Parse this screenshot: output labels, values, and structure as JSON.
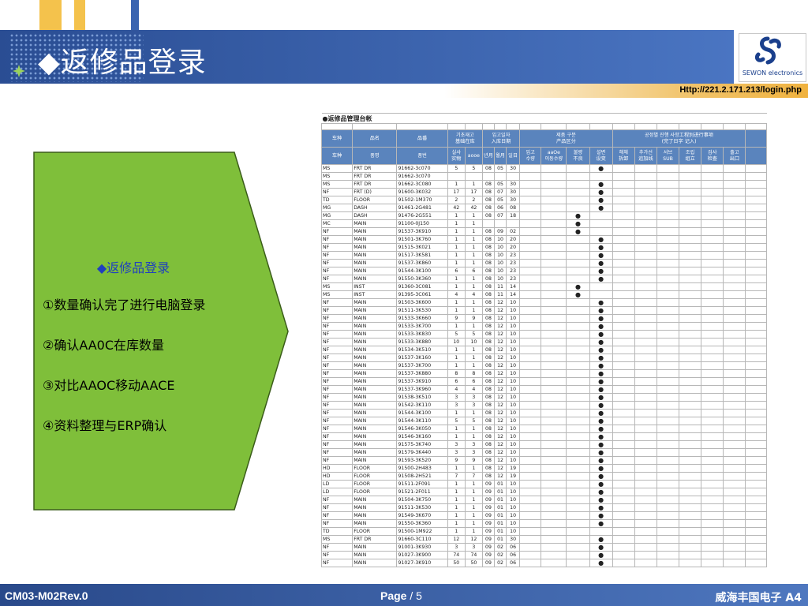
{
  "header": {
    "title": "◆返修品登录",
    "url": "Http://221.2.171.213/login.php",
    "logo_text": "SEWON electronics"
  },
  "colors": {
    "banner": "#3a64b0",
    "arrow_fill": "#7fbf3a",
    "table_header": "#5a84bd",
    "accent_yellow": "#f0b23e"
  },
  "steps": {
    "head": "◆返修品登录",
    "items": [
      "①数量确认完了进行电脑登录",
      "②确认AA0C在库数量",
      "③对比AAOC移动AACE",
      "④资料整理与ERP确认"
    ]
  },
  "table": {
    "caption": "●返修品管理台帐",
    "header1": [
      "车种",
      "品名",
      "品番",
      "기초재고\n基础在库",
      "입고일자\n入库日期",
      "제품 구분\n产品区分",
      "공정별 진행 사항工程別进行事项\n(完了日字 记入)"
    ],
    "header2": [
      "车种",
      "품명",
      "품번",
      "실사\n实物",
      "aooe",
      "년月",
      "월月",
      "일日",
      "입고\n수량",
      "aaOe\n이동수량",
      "불량\n不良",
      "설변\n设变",
      "해체\n拆卸",
      "추가선\n追加线",
      "서브\nSUB",
      "조립\n组立",
      "검사\n检查",
      "출고\n出口"
    ],
    "rows": [
      [
        "MS",
        "FRT DR",
        "91662-3c070",
        "5",
        "5",
        "08",
        "05",
        "30",
        "",
        "",
        "",
        "●"
      ],
      [
        "MS",
        "FRT DR",
        "91662-3c070",
        "",
        "",
        "",
        "",
        "",
        "",
        "",
        "",
        ""
      ],
      [
        "MS",
        "FRT DR",
        "91662-3C080",
        "1",
        "1",
        "08",
        "05",
        "30",
        "",
        "",
        "",
        "●"
      ],
      [
        "NF",
        "FRT (D)",
        "91600-3K032",
        "17",
        "17",
        "08",
        "07",
        "30",
        "",
        "",
        "",
        "●"
      ],
      [
        "TD",
        "FLOOR",
        "91502-1M370",
        "2",
        "2",
        "08",
        "05",
        "30",
        "",
        "",
        "",
        "●"
      ],
      [
        "MG",
        "DASH",
        "91461-2G481",
        "42",
        "42",
        "08",
        "06",
        "08",
        "",
        "",
        "",
        "●"
      ],
      [
        "MG",
        "DASH",
        "91476-2G551",
        "1",
        "1",
        "08",
        "07",
        "18",
        "",
        "",
        "●",
        ""
      ],
      [
        "MC",
        "MAIN",
        "91100-0J150",
        "1",
        "1",
        "",
        "",
        "",
        "",
        "",
        "●",
        ""
      ],
      [
        "NF",
        "MAIN",
        "91537-3K910",
        "1",
        "1",
        "08",
        "09",
        "02",
        "",
        "",
        "●",
        ""
      ],
      [
        "NF",
        "MAIN",
        "91501-3K760",
        "1",
        "1",
        "08",
        "10",
        "20",
        "",
        "",
        "",
        "●"
      ],
      [
        "NF",
        "MAIN",
        "91515-3K021",
        "1",
        "1",
        "08",
        "10",
        "20",
        "",
        "",
        "",
        "●"
      ],
      [
        "NF",
        "MAIN",
        "91517-3K581",
        "1",
        "1",
        "08",
        "10",
        "23",
        "",
        "",
        "",
        "●"
      ],
      [
        "NF",
        "MAIN",
        "91537-3K860",
        "1",
        "1",
        "08",
        "10",
        "23",
        "",
        "",
        "",
        "●"
      ],
      [
        "NF",
        "MAIN",
        "91544-3K100",
        "6",
        "6",
        "08",
        "10",
        "23",
        "",
        "",
        "",
        "●"
      ],
      [
        "NF",
        "MAIN",
        "91550-3K360",
        "1",
        "1",
        "08",
        "10",
        "23",
        "",
        "",
        "",
        "●"
      ],
      [
        "MS",
        "INST",
        "91360-3C081",
        "1",
        "1",
        "08",
        "11",
        "14",
        "",
        "",
        "●",
        ""
      ],
      [
        "MS",
        "INST",
        "91395-3C061",
        "4",
        "4",
        "08",
        "11",
        "14",
        "",
        "",
        "●",
        ""
      ],
      [
        "NF",
        "MAIN",
        "91503-3K600",
        "1",
        "1",
        "08",
        "12",
        "10",
        "",
        "",
        "",
        "●"
      ],
      [
        "NF",
        "MAIN",
        "91511-3K530",
        "1",
        "1",
        "08",
        "12",
        "10",
        "",
        "",
        "",
        "●"
      ],
      [
        "NF",
        "MAIN",
        "91533-3K660",
        "9",
        "9",
        "08",
        "12",
        "10",
        "",
        "",
        "",
        "●"
      ],
      [
        "NF",
        "MAIN",
        "91533-3K700",
        "1",
        "1",
        "08",
        "12",
        "10",
        "",
        "",
        "",
        "●"
      ],
      [
        "NF",
        "MAIN",
        "91533-3K830",
        "5",
        "5",
        "08",
        "12",
        "10",
        "",
        "",
        "",
        "●"
      ],
      [
        "NF",
        "MAIN",
        "91533-3K880",
        "10",
        "10",
        "08",
        "12",
        "10",
        "",
        "",
        "",
        "●"
      ],
      [
        "NF",
        "MAIN",
        "91534-3K510",
        "1",
        "1",
        "08",
        "12",
        "10",
        "",
        "",
        "",
        "●"
      ],
      [
        "NF",
        "MAIN",
        "91537-3K160",
        "1",
        "1",
        "08",
        "12",
        "10",
        "",
        "",
        "",
        "●"
      ],
      [
        "NF",
        "MAIN",
        "91537-3K700",
        "1",
        "1",
        "08",
        "12",
        "10",
        "",
        "",
        "",
        "●"
      ],
      [
        "NF",
        "MAIN",
        "91537-3K880",
        "8",
        "8",
        "08",
        "12",
        "10",
        "",
        "",
        "",
        "●"
      ],
      [
        "NF",
        "MAIN",
        "91537-3K910",
        "6",
        "6",
        "08",
        "12",
        "10",
        "",
        "",
        "",
        "●"
      ],
      [
        "NF",
        "MAIN",
        "91537-3K960",
        "4",
        "4",
        "08",
        "12",
        "10",
        "",
        "",
        "",
        "●"
      ],
      [
        "NF",
        "MAIN",
        "91538-3K510",
        "3",
        "3",
        "08",
        "12",
        "10",
        "",
        "",
        "",
        "●"
      ],
      [
        "NF",
        "MAIN",
        "91542-3K110",
        "3",
        "3",
        "08",
        "12",
        "10",
        "",
        "",
        "",
        "●"
      ],
      [
        "NF",
        "MAIN",
        "91544-3K100",
        "1",
        "1",
        "08",
        "12",
        "10",
        "",
        "",
        "",
        "●"
      ],
      [
        "NF",
        "MAIN",
        "91544-3K110",
        "5",
        "5",
        "08",
        "12",
        "10",
        "",
        "",
        "",
        "●"
      ],
      [
        "NF",
        "MAIN",
        "91546-3K050",
        "1",
        "1",
        "08",
        "12",
        "10",
        "",
        "",
        "",
        "●"
      ],
      [
        "NF",
        "MAIN",
        "91546-3K160",
        "1",
        "1",
        "08",
        "12",
        "10",
        "",
        "",
        "",
        "●"
      ],
      [
        "NF",
        "MAIN",
        "91575-3K740",
        "3",
        "3",
        "08",
        "12",
        "10",
        "",
        "",
        "",
        "●"
      ],
      [
        "NF",
        "MAIN",
        "91579-3K440",
        "3",
        "3",
        "08",
        "12",
        "10",
        "",
        "",
        "",
        "●"
      ],
      [
        "NF",
        "MAIN",
        "91593-3K520",
        "9",
        "9",
        "08",
        "12",
        "10",
        "",
        "",
        "",
        "●"
      ],
      [
        "HD",
        "FLOOR",
        "91500-2H483",
        "1",
        "1",
        "08",
        "12",
        "19",
        "",
        "",
        "",
        "●"
      ],
      [
        "HD",
        "FLOOR",
        "91508-2H521",
        "7",
        "7",
        "08",
        "12",
        "19",
        "",
        "",
        "",
        "●"
      ],
      [
        "LD",
        "FLOOR",
        "91511-2F091",
        "1",
        "1",
        "09",
        "01",
        "10",
        "",
        "",
        "",
        "●"
      ],
      [
        "LD",
        "FLOOR",
        "91521-2F011",
        "1",
        "1",
        "09",
        "01",
        "10",
        "",
        "",
        "",
        "●"
      ],
      [
        "NF",
        "MAIN",
        "91504-3K750",
        "1",
        "1",
        "09",
        "01",
        "10",
        "",
        "",
        "",
        "●"
      ],
      [
        "NF",
        "MAIN",
        "91511-3K530",
        "1",
        "1",
        "09",
        "01",
        "10",
        "",
        "",
        "",
        "●"
      ],
      [
        "NF",
        "MAIN",
        "91549-3K670",
        "1",
        "1",
        "09",
        "01",
        "10",
        "",
        "",
        "",
        "●"
      ],
      [
        "NF",
        "MAIN",
        "91550-3K360",
        "1",
        "1",
        "09",
        "01",
        "10",
        "",
        "",
        "",
        "●"
      ],
      [
        "TD",
        "FLOOR",
        "91500-1M922",
        "1",
        "1",
        "09",
        "01",
        "10",
        "",
        "",
        "",
        ""
      ],
      [
        "MS",
        "FRT DR",
        "91660-3C110",
        "12",
        "12",
        "09",
        "01",
        "30",
        "",
        "",
        "",
        "●"
      ],
      [
        "NF",
        "MAIN",
        "91001-3K930",
        "3",
        "3",
        "09",
        "02",
        "06",
        "",
        "",
        "",
        "●"
      ],
      [
        "NF",
        "MAIN",
        "91027-3K900",
        "74",
        "74",
        "09",
        "02",
        "06",
        "",
        "",
        "",
        "●"
      ],
      [
        "NF",
        "MAIN",
        "91027-3K910",
        "50",
        "50",
        "09",
        "02",
        "06",
        "",
        "",
        "",
        "●"
      ]
    ]
  },
  "footer": {
    "left": "CM03-M02Rev.0",
    "page_label": "Page",
    "page_sep": " / ",
    "page_num": "5",
    "right": "威海丰国电子 A4"
  }
}
